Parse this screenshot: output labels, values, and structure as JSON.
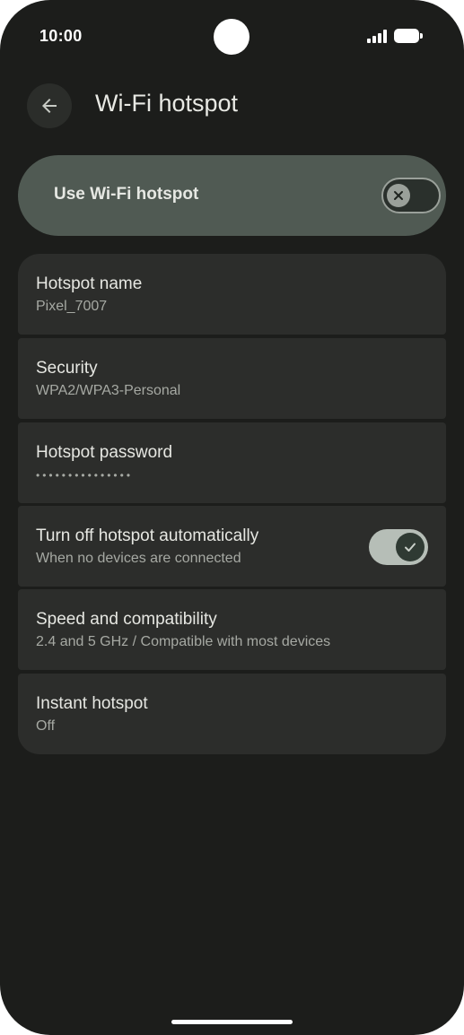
{
  "status_bar": {
    "time": "10:00",
    "signal_icon": "signal-bars-icon",
    "battery_icon": "battery-full-icon"
  },
  "header": {
    "back_icon": "arrow-back-icon",
    "title": "Wi-Fi hotspot"
  },
  "master_toggle": {
    "label": "Use Wi-Fi hotspot",
    "enabled": false,
    "thumb_icon": "close-icon"
  },
  "settings": [
    {
      "title": "Hotspot name",
      "summary": "Pixel_7007"
    },
    {
      "title": "Security",
      "summary": "WPA2/WPA3-Personal"
    },
    {
      "title": "Hotspot password",
      "summary": "•••••••••••••••"
    },
    {
      "title": "Turn off hotspot automatically",
      "summary": "When no devices are connected",
      "toggle_on": true,
      "thumb_icon": "check-icon"
    },
    {
      "title": "Speed and compatibility",
      "summary": "2.4 and 5 GHz / Compatible with most devices"
    },
    {
      "title": "Instant hotspot",
      "summary": "Off"
    }
  ],
  "colors": {
    "background": "#1c1d1b",
    "toggle_card": "#505a53",
    "list_item": "#2c2d2b",
    "switch_on_track": "#b6beb7"
  }
}
